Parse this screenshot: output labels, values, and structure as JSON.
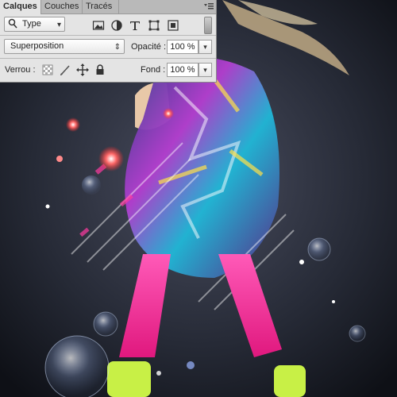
{
  "tabs": [
    {
      "label": "Calques",
      "active": true
    },
    {
      "label": "Couches",
      "active": false
    },
    {
      "label": "Tracés",
      "active": false
    }
  ],
  "filter": {
    "search_icon": "search-icon",
    "type_label": "Type"
  },
  "blend": {
    "mode": "Superposition",
    "opacity_label": "Opacité :",
    "opacity_value": "100 %"
  },
  "lock": {
    "label": "Verrou :",
    "fill_label": "Fond :",
    "fill_value": "100 %"
  },
  "colors": {
    "panel_bg": "#e4e4e4",
    "tab_bg": "#b9b9b9",
    "accent_pink": "#ff3aa0",
    "accent_lime": "#c8f046"
  }
}
